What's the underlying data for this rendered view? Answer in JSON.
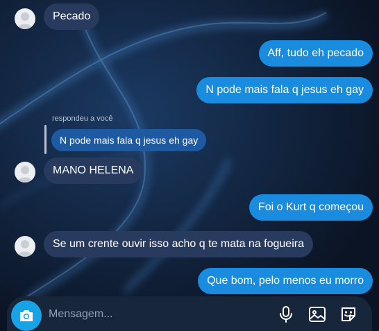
{
  "messages": {
    "m1": "Pecado",
    "m2": "Aff, tudo eh pecado",
    "m3": "N pode mais fala q jesus eh gay",
    "reply_label": "respondeu a você",
    "quoted": "N pode mais fala q jesus eh gay",
    "m4": "MANO HELENA",
    "m5": "Foi o Kurt q começou",
    "m6": "Se um crente ouvir isso acho q te mata na fogueira",
    "m7": "Que bom, pelo menos eu morro"
  },
  "composer": {
    "placeholder": "Mensagem..."
  },
  "colors": {
    "incoming_bubble": "#283a5e",
    "outgoing_bubble": "#1a8ce0",
    "camera_button": "#18a3e6",
    "background": "#0b1424"
  },
  "icons": [
    "camera-icon",
    "microphone-icon",
    "gallery-icon",
    "sticker-icon"
  ]
}
